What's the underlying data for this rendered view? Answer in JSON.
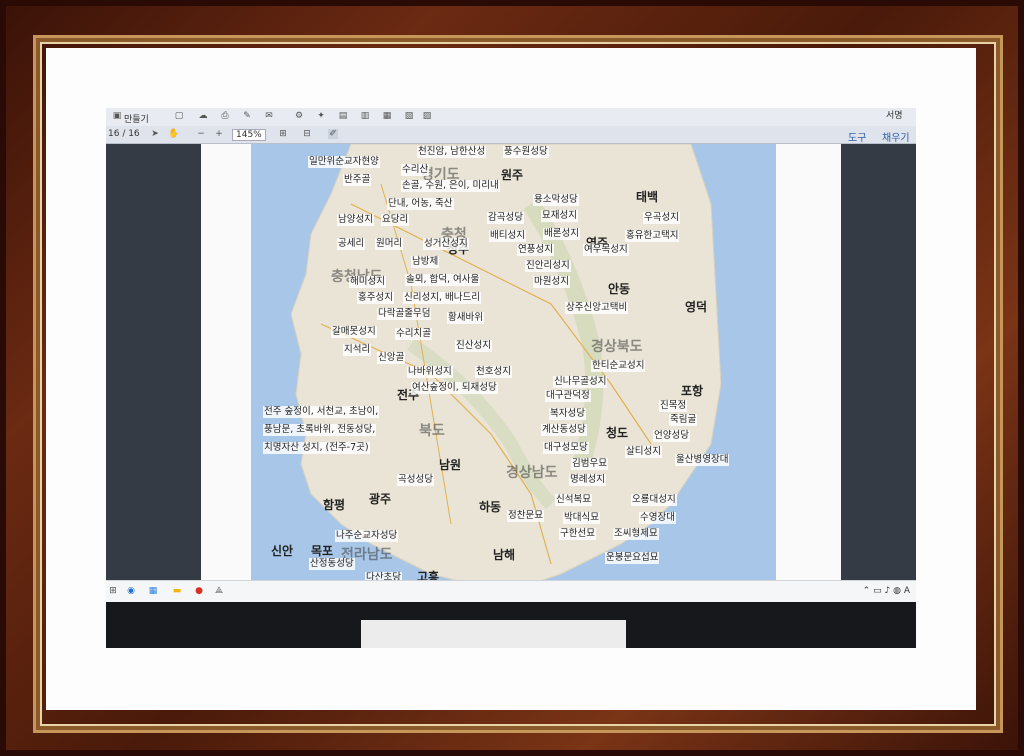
{
  "toolbar": {
    "menu_label": "만들기",
    "page_indicator": "16 / 16",
    "zoom": "145%",
    "right_tools_label": "도구",
    "right_fill_label": "채우기",
    "right_sign_label": "서명"
  },
  "map": {
    "regions": [
      "경기도",
      "충청",
      "충청남도",
      "전라남도",
      "경상북도",
      "경상남도",
      "북도"
    ],
    "cities": [
      "원주",
      "태백",
      "영주",
      "안동",
      "영덕",
      "포항",
      "청도",
      "남원",
      "광주",
      "함평",
      "목포",
      "신안",
      "하동",
      "남해",
      "고흥",
      "전주",
      "청주"
    ],
    "labels": [
      "천진암, 남한산성",
      "풍수원성당",
      "일만위순교자현양",
      "반주골",
      "수리산",
      "손골, 수원, 은이, 미리내",
      "단내, 어농, 죽산",
      "용소막성당",
      "태백",
      "남양성지",
      "요당리",
      "감곡성당",
      "묘재성지",
      "우곡성지",
      "배티성지",
      "배론성지",
      "홍유한고택지",
      "공세리",
      "원머리",
      "성거산성지",
      "연풍성지",
      "여우목성지",
      "남방제",
      "진안리성지",
      "해미성지",
      "솔뫼, 합덕, 여사울",
      "마원성지",
      "홍주성지",
      "신리성지, 배나드리",
      "다락골줄무덤",
      "황새바위",
      "상주신앙고택비",
      "갈매못성지",
      "수리치골",
      "지석리",
      "진산성지",
      "신앙골",
      "한티순교성지",
      "나바위성지",
      "천호성지",
      "신나무골성지",
      "진목정",
      "여산숲정이, 되재성당",
      "대구관덕정",
      "죽림굴",
      "전주 숲정이, 서천교, 초남이,",
      "복자성당",
      "풍남문, 초록바위, 전동성당,",
      "계산동성당",
      "언양성당",
      "치명자산 성지, (전주-7곳)",
      "대구성모당",
      "살티성지",
      "김범우묘",
      "울산병영장대",
      "곡성성당",
      "명례성지",
      "신석복묘",
      "오룡대성지",
      "정찬문묘",
      "박대식묘",
      "수영장대",
      "나주순교자성당",
      "구한선묘",
      "조씨형제묘",
      "산정동성당",
      "운봉문요섭묘",
      "다산초당"
    ]
  },
  "taskbar": {
    "tray_text": "A"
  }
}
